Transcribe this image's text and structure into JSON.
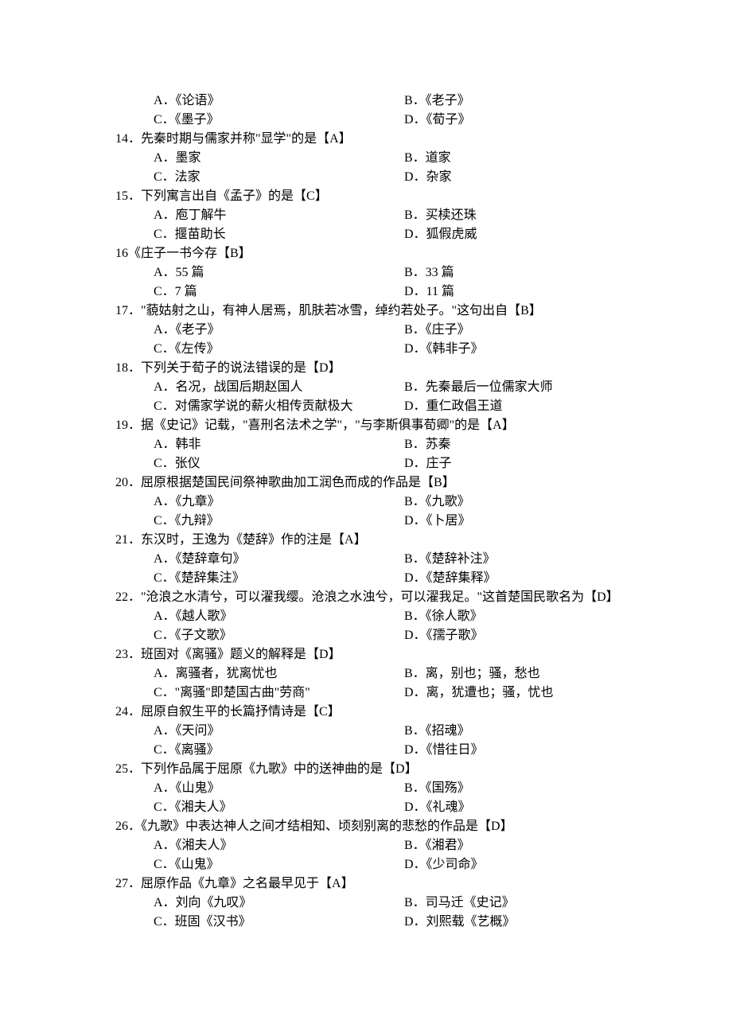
{
  "orphan": {
    "A": "A．《论语》",
    "B": "B．《老子》",
    "C": "C．《墨子》",
    "D": "D．《荀子》"
  },
  "questions": [
    {
      "num": "14．",
      "stem": "先秦时期与儒家并称\"显学\"的是【A】",
      "opts": {
        "A": "A．墨家",
        "B": "B．道家",
        "C": "C．法家",
        "D": "D．杂家"
      }
    },
    {
      "num": "15．",
      "stem": "下列寓言出自《孟子》的是【C】",
      "opts": {
        "A": "A．庖丁解牛",
        "B": "B．买椟还珠",
        "C": "C．揠苗助长",
        "D": "D．狐假虎威"
      }
    },
    {
      "num": "16",
      "stem": "《庄子一书今存【B】",
      "opts": {
        "A": "A．55 篇",
        "B": "B．33 篇",
        "C": "C．7 篇",
        "D": "D．11 篇"
      }
    },
    {
      "num": "17．",
      "stem": "\"藐姑射之山，有神人居焉，肌肤若冰雪，绰约若处子。\"这句出自【B】",
      "opts": {
        "A": "A．《老子》",
        "B": "B．《庄子》",
        "C": "C．《左传》",
        "D": "D．《韩非子》"
      }
    },
    {
      "num": "18．",
      "stem": "下列关于荀子的说法错误的是【D】",
      "opts": {
        "A": "A．名况，战国后期赵国人",
        "B": "B．先秦最后一位儒家大师",
        "C": "C．对儒家学说的薪火相传贡献极大",
        "D": "D．重仁政倡王道"
      }
    },
    {
      "num": "19．",
      "stem": "据《史记》记载，\"喜刑名法术之学\"，\"与李斯俱事荀卿\"的是【A】",
      "opts": {
        "A": "A．韩非",
        "B": "B．苏秦",
        "C": "C．张仪",
        "D": "D．庄子"
      }
    },
    {
      "num": "20．",
      "stem": "屈原根据楚国民间祭神歌曲加工润色而成的作品是【B】",
      "opts": {
        "A": "A．《九章》",
        "B": "B．《九歌》",
        "C": "C．《九辩》",
        "D": "D．《卜居》"
      }
    },
    {
      "num": "21．",
      "stem": "东汉时，王逸为《楚辞》作的注是【A】",
      "opts": {
        "A": "A．《楚辞章句》",
        "B": "B．《楚辞补注》",
        "C": "C．《楚辞集注》",
        "D": "D．《楚辞集释》"
      }
    },
    {
      "num": "22．",
      "stem": "\"沧浪之水清兮，可以濯我缨。沧浪之水浊兮，可以濯我足。\"这首楚国民歌名为【D】",
      "opts": {
        "A": "A．《越人歌》",
        "B": "B．《徐人歌》",
        "C": "C．《子文歌》",
        "D": "D．《孺子歌》"
      }
    },
    {
      "num": "23．",
      "stem": "班固对《离骚》题义的解释是【D】",
      "opts": {
        "A": "A．离骚者，犹离忧也",
        "B": "B．离，别也；骚，愁也",
        "C": "C．\"离骚\"即楚国古曲\"劳商\"",
        "D": "D．离，犹遭也；骚，忧也"
      }
    },
    {
      "num": "24．",
      "stem": "屈原自叙生平的长篇抒情诗是【C】",
      "opts": {
        "A": "A．《天问》",
        "B": "B．《招魂》",
        "C": "C．《离骚》",
        "D": "D．《惜往日》"
      }
    },
    {
      "num": "25．",
      "stem": "下列作品属于屈原《九歌》中的送神曲的是【D】",
      "opts": {
        "A": "A．《山鬼》",
        "B": "B．《国殇》",
        "C": "C．《湘夫人》",
        "D": "D．《礼魂》"
      }
    },
    {
      "num": "26．",
      "stem": "《九歌》中表达神人之间才结相知、顷刻别离的悲愁的作品是【D】",
      "opts": {
        "A": "A．《湘夫人》",
        "B": "B．《湘君》",
        "C": "C．《山鬼》",
        "D": "D．《少司命》"
      }
    },
    {
      "num": "27．",
      "stem": "屈原作品《九章》之名最早见于【A】",
      "opts": {
        "A": "A．刘向《九叹》",
        "B": "B．司马迁《史记》",
        "C": "C．班固《汉书》",
        "D": "D．刘熙载《艺概》"
      }
    }
  ]
}
